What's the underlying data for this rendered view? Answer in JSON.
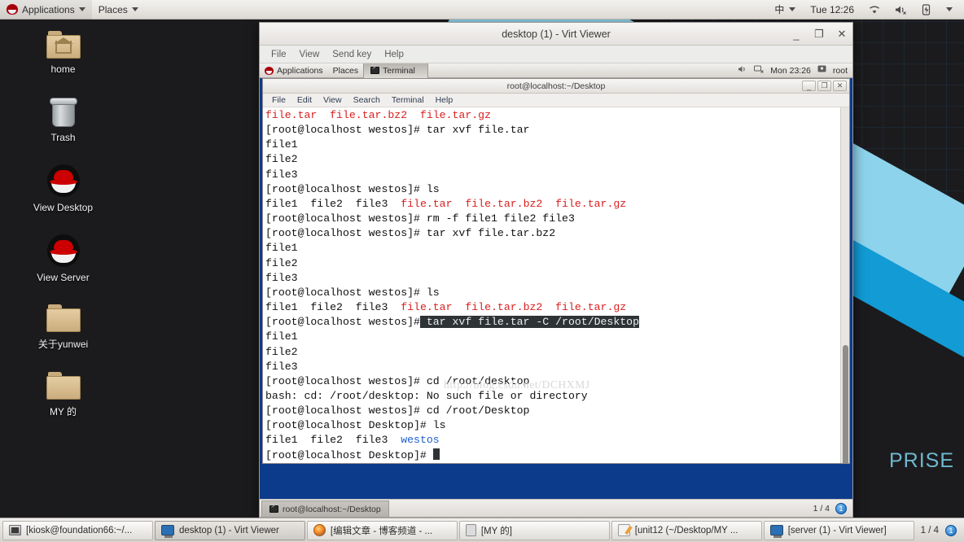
{
  "host_panel": {
    "applications_label": "Applications",
    "places_label": "Places",
    "input_method": "中",
    "clock": "Tue 12:26",
    "icons": [
      "redhat-logo-icon",
      "wifi-icon",
      "volume-muted-icon",
      "battery-icon",
      "chevron-down-icon"
    ]
  },
  "desktop": {
    "wallpaper_word": "PRISE",
    "icons": [
      {
        "label": "home",
        "icon": "home-folder-icon"
      },
      {
        "label": "Trash",
        "icon": "trash-icon"
      },
      {
        "label": "View Desktop",
        "icon": "redhat-icon"
      },
      {
        "label": "View Server",
        "icon": "redhat-icon"
      },
      {
        "label": "关于yunwei",
        "icon": "folder-icon"
      },
      {
        "label": "MY 的",
        "icon": "folder-icon"
      }
    ]
  },
  "virt_viewer": {
    "title": "desktop (1) - Virt Viewer",
    "menus": [
      "File",
      "View",
      "Send key",
      "Help"
    ],
    "window_buttons": {
      "minimize": "_",
      "maximize": "❐",
      "close": "✕"
    },
    "statusbar": {
      "tab_label": "root@localhost:~/Desktop",
      "page": "1 / 4",
      "badge": "1"
    }
  },
  "guest_panel": {
    "applications_label": "Applications",
    "places_label": "Places",
    "task_label": "Terminal",
    "clock": "Mon 23:26",
    "user": "root",
    "icons": [
      "redhat-logo-icon",
      "terminal-icon",
      "volume-icon",
      "network-disconnected-icon",
      "user-icon"
    ]
  },
  "terminal": {
    "title": "root@localhost:~/Desktop",
    "menus": [
      "File",
      "Edit",
      "View",
      "Search",
      "Terminal",
      "Help"
    ],
    "window_buttons": {
      "minimize": "_",
      "maximize": "❐",
      "close": "✕"
    },
    "watermark": "http://blog.csdn.net/DCHXMJ",
    "lines": [
      {
        "segs": [
          {
            "t": "file.tar  file.tar.bz2  file.tar.gz",
            "c": "red"
          }
        ]
      },
      {
        "segs": [
          {
            "t": "[root@localhost westos]# tar xvf file.tar",
            "c": ""
          }
        ]
      },
      {
        "segs": [
          {
            "t": "file1",
            "c": ""
          }
        ]
      },
      {
        "segs": [
          {
            "t": "file2",
            "c": ""
          }
        ]
      },
      {
        "segs": [
          {
            "t": "file3",
            "c": ""
          }
        ]
      },
      {
        "segs": [
          {
            "t": "[root@localhost westos]# ls",
            "c": ""
          }
        ]
      },
      {
        "segs": [
          {
            "t": "file1  file2  file3  ",
            "c": ""
          },
          {
            "t": "file.tar  file.tar.bz2  file.tar.gz",
            "c": "red"
          }
        ]
      },
      {
        "segs": [
          {
            "t": "[root@localhost westos]# rm -f file1 file2 file3",
            "c": ""
          }
        ]
      },
      {
        "segs": [
          {
            "t": "[root@localhost westos]# tar xvf file.tar.bz2",
            "c": ""
          }
        ]
      },
      {
        "segs": [
          {
            "t": "file1",
            "c": ""
          }
        ]
      },
      {
        "segs": [
          {
            "t": "file2",
            "c": ""
          }
        ]
      },
      {
        "segs": [
          {
            "t": "file3",
            "c": ""
          }
        ]
      },
      {
        "segs": [
          {
            "t": "[root@localhost westos]# ls",
            "c": ""
          }
        ]
      },
      {
        "segs": [
          {
            "t": "file1  file2  file3  ",
            "c": ""
          },
          {
            "t": "file.tar  file.tar.bz2  file.tar.gz",
            "c": "red"
          }
        ]
      },
      {
        "segs": [
          {
            "t": "[root@localhost westos]#",
            "c": ""
          },
          {
            "t": " tar xvf file.tar -C /root/Desktop",
            "c": "hl"
          }
        ]
      },
      {
        "segs": [
          {
            "t": "file1",
            "c": ""
          }
        ]
      },
      {
        "segs": [
          {
            "t": "file2",
            "c": ""
          }
        ]
      },
      {
        "segs": [
          {
            "t": "file3",
            "c": ""
          }
        ]
      },
      {
        "segs": [
          {
            "t": "[root@localhost westos]# cd /root/desktop",
            "c": ""
          }
        ]
      },
      {
        "segs": [
          {
            "t": "bash: cd: /root/desktop: No such file or directory",
            "c": ""
          }
        ]
      },
      {
        "segs": [
          {
            "t": "[root@localhost westos]# cd /root/Desktop",
            "c": ""
          }
        ]
      },
      {
        "segs": [
          {
            "t": "[root@localhost Desktop]# ls",
            "c": ""
          }
        ]
      },
      {
        "segs": [
          {
            "t": "file1  file2  file3  ",
            "c": ""
          },
          {
            "t": "westos",
            "c": "blue"
          }
        ]
      },
      {
        "segs": [
          {
            "t": "[root@localhost Desktop]# ",
            "c": ""
          },
          {
            "t": "",
            "c": "cursor"
          }
        ]
      }
    ]
  },
  "taskbar": {
    "items": [
      {
        "label": "[kiosk@foundation66:~/...",
        "icon": "terminal-icon",
        "active": false
      },
      {
        "label": "desktop (1) - Virt Viewer",
        "icon": "monitor-icon",
        "active": true
      },
      {
        "label": "[编辑文章 - 博客频道 - ...",
        "icon": "firefox-icon",
        "active": false
      },
      {
        "label": "[MY 的]",
        "icon": "files-icon",
        "active": false
      },
      {
        "label": "[unit12 (~/Desktop/MY ...",
        "icon": "editor-icon",
        "active": false
      },
      {
        "label": "[server (1) - Virt Viewer]",
        "icon": "monitor-icon",
        "active": false
      }
    ],
    "page": "1 / 4",
    "badge": "1"
  }
}
